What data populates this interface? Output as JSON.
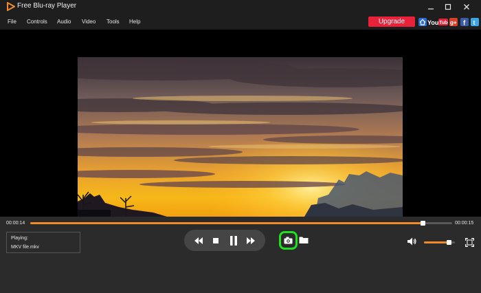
{
  "app": {
    "title": "Free Blu-ray Player",
    "accent": "#f08a2a"
  },
  "menu": {
    "items": [
      "File",
      "Controls",
      "Audio",
      "Video",
      "Tools",
      "Help"
    ]
  },
  "upgrade": {
    "label": "Upgrade",
    "color": "#e8223a"
  },
  "social": {
    "youtube_label": "YouTube",
    "icons": [
      "home-icon",
      "youtube-icon",
      "google-plus-icon",
      "facebook-icon",
      "twitter-icon"
    ]
  },
  "playback": {
    "current_time": "00:00:14",
    "total_time": "00:00:15",
    "progress_fraction": 0.93,
    "volume_fraction": 0.8
  },
  "now_playing": {
    "label": "Playing:",
    "file": "MKV file.mkv"
  },
  "highlight": {
    "snapshot_outline": "#1ee21e"
  }
}
